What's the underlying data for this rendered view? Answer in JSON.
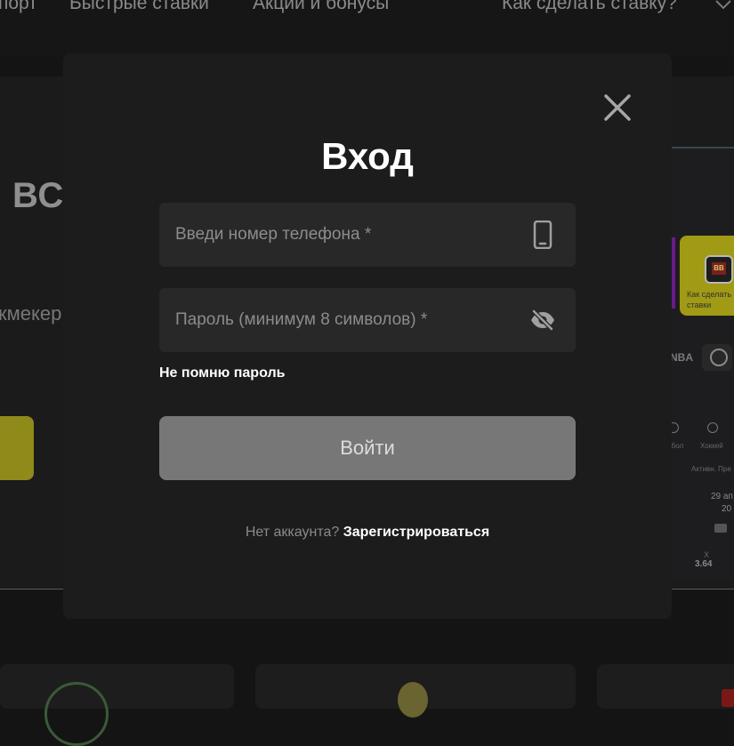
{
  "nav": {
    "items": [
      "порт",
      "Быстрые ставки",
      "Акции и бонусы",
      "Как сделать ставку?"
    ]
  },
  "hero": {
    "title": "ВС",
    "subtitle": "кмекер"
  },
  "app_preview": {
    "promo_logo_text": "BB",
    "promo_text": "Как сделать ставки",
    "sport_tab": "NBA",
    "sports": [
      "тбол",
      "Хоккей"
    ],
    "tabs_text": "Активн. Пре",
    "match_date": "29 ап",
    "match_year": "20",
    "odd_label": "Х",
    "odd_value": "3.64"
  },
  "modal": {
    "title": "Вход",
    "phone_placeholder": "Введи номер телефона *",
    "password_placeholder": "Пароль (минимум 8 символов) *",
    "forgot_password": "Не помню пароль",
    "login_button": "Войти",
    "no_account": "Нет аккаунта?",
    "register_link": "Зарегистрироваться"
  },
  "icons": {
    "close": "close-icon",
    "phone": "phone-icon",
    "password_toggle": "eye-slash-icon"
  },
  "colors": {
    "modal_bg": "#1c1c1c",
    "field_bg": "#282828",
    "button_disabled": "#777777",
    "accent_yellow": "#a09a14"
  }
}
